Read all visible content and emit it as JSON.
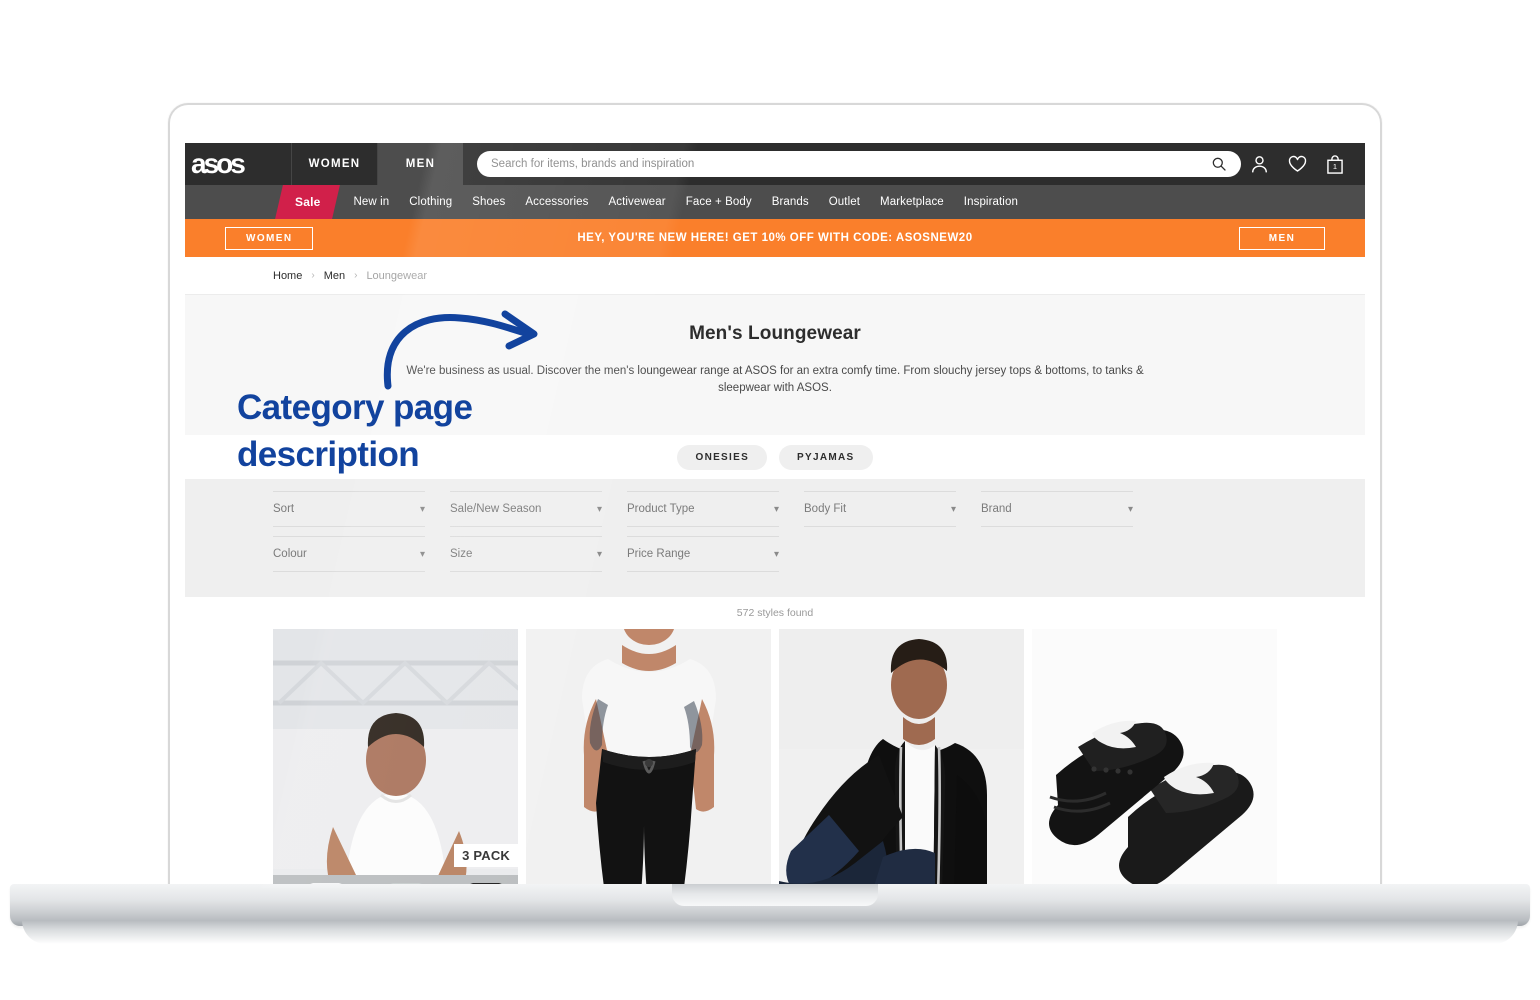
{
  "annotation": {
    "line1": "Category page",
    "line2": "description",
    "color": "#12439e"
  },
  "colors": {
    "header_bg": "#2d2d2d",
    "nav_bg": "#4d4d4d",
    "sale_badge": "#d1204a",
    "promo_bg": "#fa7f2b",
    "hero_bg": "#f7f7f7",
    "filters_bg": "#efefef",
    "annotation": "#12439e"
  },
  "header": {
    "logo": "asos",
    "logo_icon": "asos-wordmark-logo",
    "gender_tabs": [
      {
        "label": "WOMEN",
        "active": false
      },
      {
        "label": "MEN",
        "active": true
      }
    ],
    "search": {
      "placeholder": "Search for items, brands and inspiration",
      "value": "",
      "icon": "search-icon"
    },
    "icons": [
      {
        "name": "account-icon",
        "label": "My Account"
      },
      {
        "name": "heart-icon",
        "label": "Saved Items"
      },
      {
        "name": "bag-icon",
        "label": "Bag"
      }
    ],
    "bag_count": "1"
  },
  "nav": {
    "sale_label": "Sale",
    "links": [
      "New in",
      "Clothing",
      "Shoes",
      "Accessories",
      "Activewear",
      "Face + Body",
      "Brands",
      "Outlet",
      "Marketplace",
      "Inspiration"
    ]
  },
  "promo": {
    "left_button": "WOMEN",
    "message": "HEY, YOU'RE NEW HERE! GET 10% OFF WITH CODE: ASOSNEW20",
    "right_button": "MEN"
  },
  "breadcrumb": {
    "items": [
      {
        "label": "Home",
        "current": false
      },
      {
        "label": "Men",
        "current": false
      },
      {
        "label": "Loungewear",
        "current": true
      }
    ],
    "separator": "›"
  },
  "hero": {
    "title": "Men's Loungewear",
    "description": "We're business as usual. Discover the men's loungewear range at ASOS for an extra comfy time. From slouchy jersey tops & bottoms, to tanks & sleepwear with ASOS."
  },
  "pills": [
    {
      "label": "ONESIES"
    },
    {
      "label": "PYJAMAS"
    }
  ],
  "filters": [
    {
      "label": "Sort",
      "icon": "chevron-down-icon"
    },
    {
      "label": "Sale/New Season",
      "icon": "chevron-down-icon"
    },
    {
      "label": "Product Type",
      "icon": "chevron-down-icon"
    },
    {
      "label": "Body Fit",
      "icon": "chevron-down-icon"
    },
    {
      "label": "Brand",
      "icon": "chevron-down-icon"
    },
    {
      "label": "Colour",
      "icon": "chevron-down-icon"
    },
    {
      "label": "Size",
      "icon": "chevron-down-icon"
    },
    {
      "label": "Price Range",
      "icon": "chevron-down-icon"
    }
  ],
  "results": {
    "count_text": "572 styles found"
  },
  "products": [
    {
      "name": "white-tshirt-3-pack",
      "badge": "3 PACK"
    },
    {
      "name": "black-joggers-with-white-tee",
      "badge": ""
    },
    {
      "name": "black-zip-up-hoodie",
      "badge": ""
    },
    {
      "name": "black-lacoste-sliders",
      "badge": ""
    }
  ]
}
